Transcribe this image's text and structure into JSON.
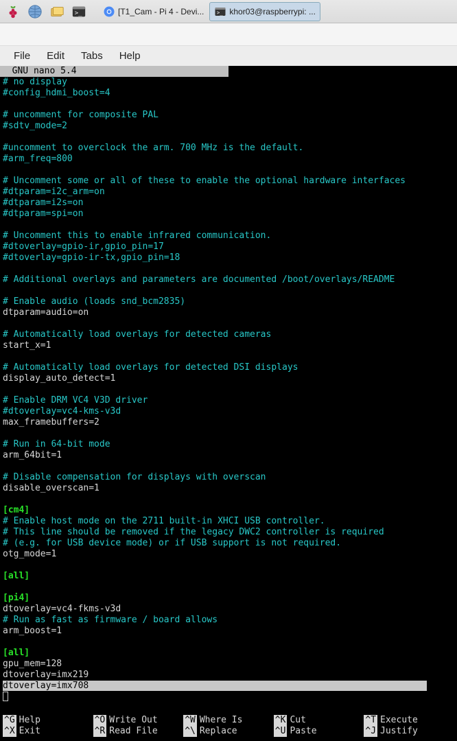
{
  "taskbar": {
    "tasks": [
      {
        "label": "[T1_Cam - Pi 4 - Devi...",
        "icon": "chromium"
      },
      {
        "label": "khor03@raspberrypi: ...",
        "icon": "terminal"
      }
    ]
  },
  "menubar": {
    "file": "File",
    "edit": "Edit",
    "tabs": "Tabs",
    "help": "Help"
  },
  "nano": {
    "title": "  GNU nano 5.4                            ",
    "highlighted_line": "dtoverlay=imx708                                                               ",
    "lines": [
      {
        "cls": "c-comment",
        "text": "# no display"
      },
      {
        "cls": "c-comment",
        "text": "#config_hdmi_boost=4"
      },
      {
        "cls": "c-comment",
        "text": ""
      },
      {
        "cls": "c-comment",
        "text": "# uncomment for composite PAL"
      },
      {
        "cls": "c-comment",
        "text": "#sdtv_mode=2"
      },
      {
        "cls": "c-comment",
        "text": ""
      },
      {
        "cls": "c-comment",
        "text": "#uncomment to overclock the arm. 700 MHz is the default."
      },
      {
        "cls": "c-comment",
        "text": "#arm_freq=800"
      },
      {
        "cls": "c-comment",
        "text": ""
      },
      {
        "cls": "c-comment",
        "text": "# Uncomment some or all of these to enable the optional hardware interfaces"
      },
      {
        "cls": "c-comment",
        "text": "#dtparam=i2c_arm=on"
      },
      {
        "cls": "c-comment",
        "text": "#dtparam=i2s=on"
      },
      {
        "cls": "c-comment",
        "text": "#dtparam=spi=on"
      },
      {
        "cls": "c-comment",
        "text": ""
      },
      {
        "cls": "c-comment",
        "text": "# Uncomment this to enable infrared communication."
      },
      {
        "cls": "c-comment",
        "text": "#dtoverlay=gpio-ir,gpio_pin=17"
      },
      {
        "cls": "c-comment",
        "text": "#dtoverlay=gpio-ir-tx,gpio_pin=18"
      },
      {
        "cls": "c-comment",
        "text": ""
      },
      {
        "cls": "c-comment",
        "text": "# Additional overlays and parameters are documented /boot/overlays/README"
      },
      {
        "cls": "c-comment",
        "text": ""
      },
      {
        "cls": "c-comment",
        "text": "# Enable audio (loads snd_bcm2835)"
      },
      {
        "cls": "c-normal",
        "text": "dtparam=audio=on"
      },
      {
        "cls": "c-comment",
        "text": ""
      },
      {
        "cls": "c-comment",
        "text": "# Automatically load overlays for detected cameras"
      },
      {
        "cls": "c-normal",
        "text": "start_x=1"
      },
      {
        "cls": "c-comment",
        "text": ""
      },
      {
        "cls": "c-comment",
        "text": "# Automatically load overlays for detected DSI displays"
      },
      {
        "cls": "c-normal",
        "text": "display_auto_detect=1"
      },
      {
        "cls": "c-comment",
        "text": ""
      },
      {
        "cls": "c-comment",
        "text": "# Enable DRM VC4 V3D driver"
      },
      {
        "cls": "c-comment",
        "text": "#dtoverlay=vc4-kms-v3d"
      },
      {
        "cls": "c-normal",
        "text": "max_framebuffers=2"
      },
      {
        "cls": "c-comment",
        "text": ""
      },
      {
        "cls": "c-comment",
        "text": "# Run in 64-bit mode"
      },
      {
        "cls": "c-normal",
        "text": "arm_64bit=1"
      },
      {
        "cls": "c-comment",
        "text": ""
      },
      {
        "cls": "c-comment",
        "text": "# Disable compensation for displays with overscan"
      },
      {
        "cls": "c-normal",
        "text": "disable_overscan=1"
      },
      {
        "cls": "c-comment",
        "text": ""
      },
      {
        "cls": "c-section",
        "text": "[cm4]"
      },
      {
        "cls": "c-comment",
        "text": "# Enable host mode on the 2711 built-in XHCI USB controller."
      },
      {
        "cls": "c-comment",
        "text": "# This line should be removed if the legacy DWC2 controller is required"
      },
      {
        "cls": "c-comment",
        "text": "# (e.g. for USB device mode) or if USB support is not required."
      },
      {
        "cls": "c-normal",
        "text": "otg_mode=1"
      },
      {
        "cls": "c-comment",
        "text": ""
      },
      {
        "cls": "c-section",
        "text": "[all]"
      },
      {
        "cls": "c-comment",
        "text": ""
      },
      {
        "cls": "c-section",
        "text": "[pi4]"
      },
      {
        "cls": "c-normal",
        "text": "dtoverlay=vc4-fkms-v3d"
      },
      {
        "cls": "c-comment",
        "text": "# Run as fast as firmware / board allows"
      },
      {
        "cls": "c-normal",
        "text": "arm_boost=1"
      },
      {
        "cls": "c-comment",
        "text": ""
      },
      {
        "cls": "c-section",
        "text": "[all]"
      },
      {
        "cls": "c-normal",
        "text": "gpu_mem=128"
      },
      {
        "cls": "c-normal",
        "text": "dtoverlay=imx219"
      }
    ],
    "help": {
      "row1": [
        {
          "key": "^G",
          "label": "Help"
        },
        {
          "key": "^O",
          "label": "Write Out"
        },
        {
          "key": "^W",
          "label": "Where Is"
        },
        {
          "key": "^K",
          "label": "Cut"
        },
        {
          "key": "^T",
          "label": "Execute"
        }
      ],
      "row2": [
        {
          "key": "^X",
          "label": "Exit"
        },
        {
          "key": "^R",
          "label": "Read File"
        },
        {
          "key": "^\\",
          "label": "Replace"
        },
        {
          "key": "^U",
          "label": "Paste"
        },
        {
          "key": "^J",
          "label": "Justify"
        }
      ]
    }
  }
}
